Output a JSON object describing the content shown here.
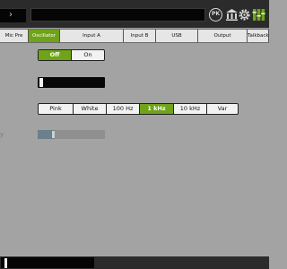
{
  "header": {
    "pk_label": "PK",
    "icons": {
      "menu": "chevron-right-icon",
      "pk": "pk-circle-icon",
      "bank": "bank-icon",
      "settings": "gear-icon",
      "mixer": "mixer-faders-icon"
    }
  },
  "tabs": [
    {
      "label": "Mic Pre",
      "active": false
    },
    {
      "label": "Oscillator",
      "active": true
    },
    {
      "label": "Input A",
      "active": false
    },
    {
      "label": "Input B",
      "active": false
    },
    {
      "label": "USB",
      "active": false
    },
    {
      "label": "Output",
      "active": false
    },
    {
      "label": "Talkback",
      "active": false
    }
  ],
  "oscillator": {
    "power": {
      "options": [
        "Off",
        "On"
      ],
      "selected": "Off"
    },
    "level": 0.02,
    "type": {
      "options": [
        "Pink",
        "White",
        "100 Hz",
        "1 kHz",
        "10 kHz",
        "Var"
      ],
      "selected": "1 kHz"
    },
    "frequency_label": "y",
    "frequency": 0.25
  },
  "bottom": {
    "level": 0.04
  },
  "colors": {
    "accent": "#6fa318",
    "background": "#a3a3a3",
    "topbar": "#2b2b2b"
  }
}
